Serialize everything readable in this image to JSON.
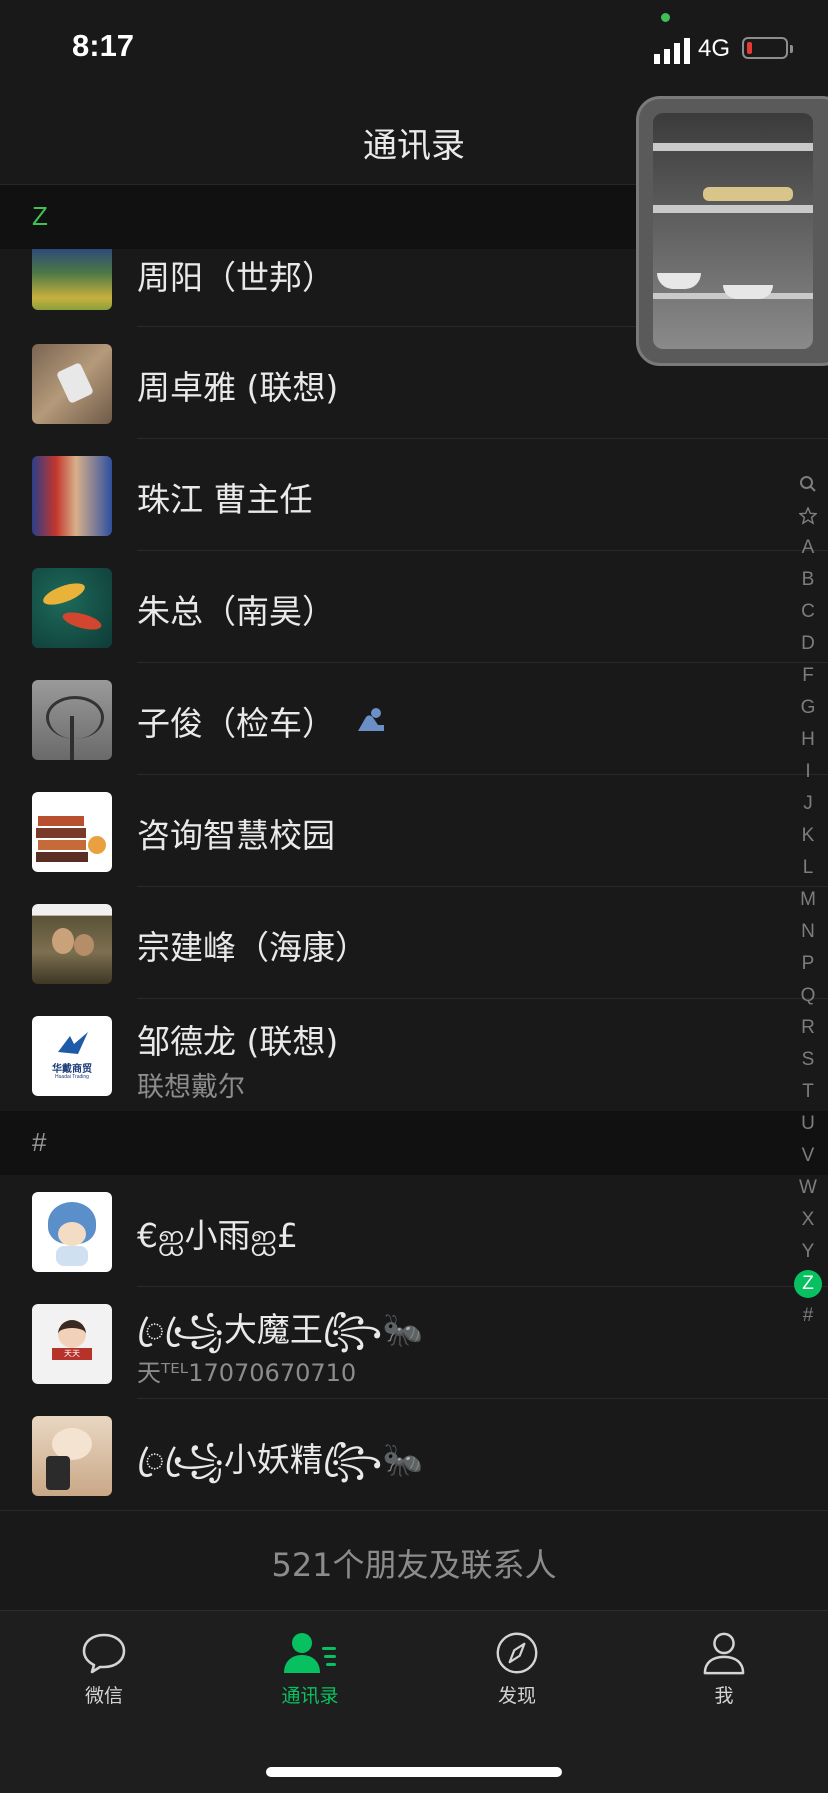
{
  "status": {
    "time": "8:17",
    "network": "4G"
  },
  "header": {
    "title": "通讯录"
  },
  "sections": [
    {
      "letter": "Z",
      "color": "#3fbf55"
    },
    {
      "letter": "#",
      "color": "#9a9a9a"
    }
  ],
  "contacts": [
    {
      "name": "周阳（世邦）"
    },
    {
      "name": "周卓雅 (联想)"
    },
    {
      "name": "珠江 曹主任"
    },
    {
      "name": "朱总（南昊）"
    },
    {
      "name": "子俊（检车）",
      "badge_icon": "wework-person-icon"
    },
    {
      "name": "咨询智慧校园"
    },
    {
      "name": "宗建峰（海康）"
    },
    {
      "name": "邹德龙 (联想)",
      "subtitle": "联想戴尔",
      "logo_text": "华戴商贸",
      "logo_sub": "Huadai Trading"
    },
    {
      "name": "€ஐ小雨ஐ£"
    },
    {
      "name": "ꦿ꧁ꦿ大魔王꧂ꦿ🐜",
      "subtitle": "天ᵀᴱᴸ17070670710",
      "sign_text": "天天"
    },
    {
      "name": "ꦿ꧁ꦿ小妖精꧂ꦿ🐜"
    }
  ],
  "index": [
    "search",
    "star",
    "A",
    "B",
    "C",
    "D",
    "F",
    "G",
    "H",
    "I",
    "J",
    "K",
    "L",
    "M",
    "N",
    "P",
    "Q",
    "R",
    "S",
    "T",
    "U",
    "V",
    "W",
    "X",
    "Y",
    "Z",
    "#"
  ],
  "index_active": "Z",
  "footer": {
    "count_text": "521个朋友及联系人"
  },
  "tabs": [
    {
      "label": "微信",
      "icon": "chat-bubble-icon"
    },
    {
      "label": "通讯录",
      "icon": "contacts-icon",
      "active": true
    },
    {
      "label": "发现",
      "icon": "compass-icon"
    },
    {
      "label": "我",
      "icon": "person-icon"
    }
  ],
  "colors": {
    "accent": "#07c160",
    "background": "#191919",
    "section_bg": "#111111"
  }
}
